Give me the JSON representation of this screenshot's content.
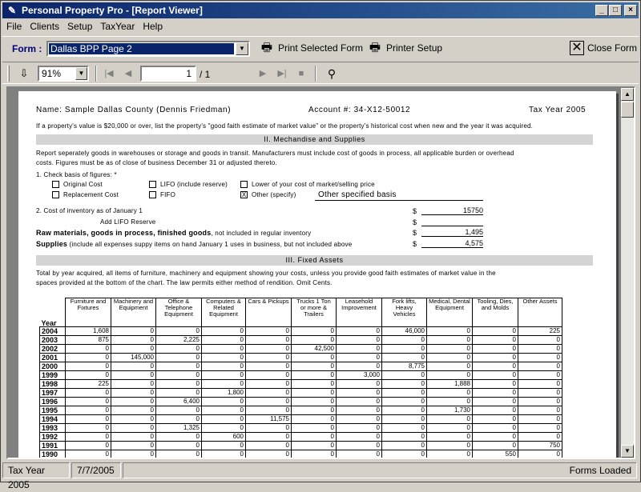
{
  "window": {
    "title": "Personal Property Pro - [Report Viewer]"
  },
  "menu": [
    "File",
    "Clients",
    "Setup",
    "TaxYear",
    "Help"
  ],
  "formbar": {
    "label": "Form :",
    "selected_form": "Dallas BPP Page 2",
    "print_selected": "Print Selected Form",
    "printer_setup": "Printer Setup",
    "close_form": "Close Form"
  },
  "viewer_toolbar": {
    "zoom": "91%",
    "page": "1",
    "page_total": "/ 1"
  },
  "report": {
    "name_line": "Name: Sample Dallas County (Dennis Friedman)",
    "account": "Account #: 34-X12-50012",
    "tax_year": "Tax Year 2005",
    "intro": "If a property's value is $20,000 or over, list the property's \"good faith estimate of market value\" or the property's historical cost when new and the year it was acquired.",
    "section2_title": "II. Mechandise and Supplies",
    "section2_text1": "Report seperately goods in warehouses or storage and goods in transit.  Manufacturers must include cost of goods in process, all applicable burden or overhead",
    "section2_text2": "costs.  Figures must be as of close of business December 31 or adjusted thereto.",
    "check_basis": "1.  Check basis of figures: *",
    "opt_original": "Original Cost",
    "opt_lifo": "LIFO (include reserve)",
    "opt_lower": "Lower of your cost of market/selling price",
    "opt_replacement": "Replacement Cost",
    "opt_fifo": "FIFO",
    "opt_other": "Other (specify)",
    "other_specified": "Other specified basis",
    "other_mark": "X",
    "cost_inventory": "2.  Cost of inventory as of January 1",
    "cost_inventory_value": "15750",
    "add_lifo": "Add LIFO Reserve",
    "add_lifo_value": "",
    "raw_materials_bold": "Raw materials, goods in process, finished goods",
    "raw_materials_rest": ", not included in regular inventory",
    "raw_materials_value": "1,495",
    "supplies_bold": "Supplies",
    "supplies_rest": " (include all expenses suppy items on hand January 1 uses in business, but not included above",
    "supplies_value": "4,575",
    "dollar": "$",
    "section3_title": "III. Fixed Assets",
    "section3_text1": "Total by year acquired, all items of furniture, machinery and equipment showing your costs, unless you provide good faith estimates of market value in the",
    "section3_text2": "spaces provided at the bottom of the chart.  The law permits either method of rendition.  Omit Cents.",
    "year_header": "Year",
    "columns": [
      "Furniture and Fixtures",
      "Machinery and Equipment",
      "Office & Telephone Equipment",
      "Computers & Related Equipment",
      "Cars & Pickups",
      "Trucks 1 Ton or more & Trailers",
      "Leasehold Improvement",
      "Fork lifts, Heavy Vehicles",
      "Medical, Dental Equipment",
      "Tooling, Dies, and Molds",
      "Other Assets"
    ],
    "rows": [
      {
        "year": "2004",
        "values": [
          "1,608",
          "0",
          "0",
          "0",
          "0",
          "0",
          "0",
          "46,000",
          "0",
          "0",
          "225"
        ]
      },
      {
        "year": "2003",
        "values": [
          "875",
          "0",
          "2,225",
          "0",
          "0",
          "0",
          "0",
          "0",
          "0",
          "0",
          "0"
        ]
      },
      {
        "year": "2002",
        "values": [
          "0",
          "0",
          "0",
          "0",
          "0",
          "42,500",
          "0",
          "0",
          "0",
          "0",
          "0"
        ]
      },
      {
        "year": "2001",
        "values": [
          "0",
          "145,000",
          "0",
          "0",
          "0",
          "0",
          "0",
          "0",
          "0",
          "0",
          "0"
        ]
      },
      {
        "year": "2000",
        "values": [
          "0",
          "0",
          "0",
          "0",
          "0",
          "0",
          "0",
          "8,775",
          "0",
          "0",
          "0"
        ]
      },
      {
        "year": "1999",
        "values": [
          "0",
          "0",
          "0",
          "0",
          "0",
          "0",
          "3,000",
          "0",
          "0",
          "0",
          "0"
        ]
      },
      {
        "year": "1998",
        "values": [
          "225",
          "0",
          "0",
          "0",
          "0",
          "0",
          "0",
          "0",
          "1,888",
          "0",
          "0"
        ]
      },
      {
        "year": "1997",
        "values": [
          "0",
          "0",
          "0",
          "1,800",
          "0",
          "0",
          "0",
          "0",
          "0",
          "0",
          "0"
        ]
      },
      {
        "year": "1996",
        "values": [
          "0",
          "0",
          "6,400",
          "0",
          "0",
          "0",
          "0",
          "0",
          "0",
          "0",
          "0"
        ]
      },
      {
        "year": "1995",
        "values": [
          "0",
          "0",
          "0",
          "0",
          "0",
          "0",
          "0",
          "0",
          "1,730",
          "0",
          "0"
        ]
      },
      {
        "year": "1994",
        "values": [
          "0",
          "0",
          "0",
          "0",
          "11,575",
          "0",
          "0",
          "0",
          "0",
          "0",
          "0"
        ]
      },
      {
        "year": "1993",
        "values": [
          "0",
          "0",
          "1,325",
          "0",
          "0",
          "0",
          "0",
          "0",
          "0",
          "0",
          "0"
        ]
      },
      {
        "year": "1992",
        "values": [
          "0",
          "0",
          "0",
          "600",
          "0",
          "0",
          "0",
          "0",
          "0",
          "0",
          "0"
        ]
      },
      {
        "year": "1991",
        "values": [
          "0",
          "0",
          "0",
          "0",
          "0",
          "0",
          "0",
          "0",
          "0",
          "0",
          "750"
        ]
      },
      {
        "year": "1990",
        "values": [
          "0",
          "0",
          "0",
          "0",
          "0",
          "0",
          "0",
          "0",
          "0",
          "550",
          "0"
        ]
      }
    ]
  },
  "statusbar": {
    "tax_year": "Tax Year 2005",
    "date": "7/7/2005",
    "status": "Forms Loaded"
  },
  "icons": {
    "app": "app-icon",
    "print_form": "printer-icon",
    "printer_setup": "printer-setup-icon",
    "close_form": "close-x-icon",
    "export": "export-icon",
    "search": "binoculars-icon"
  }
}
